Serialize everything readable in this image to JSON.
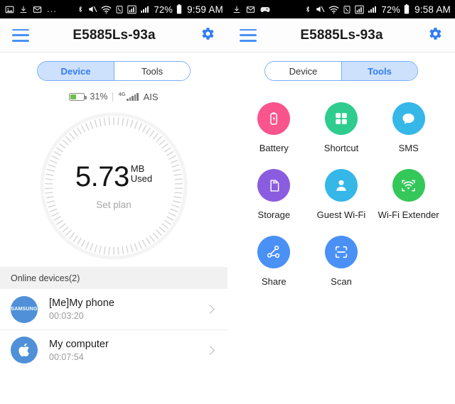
{
  "colors": {
    "accent_blue": "#4a90f5",
    "tab_active_bg": "#cde1fd",
    "tab_active_text": "#2f7cf6",
    "battery_green": "#6ec04a",
    "avatar_blue": "#4f90d8",
    "pink": "#f9548c",
    "green": "#2ecc8f",
    "sms_blue": "#35b7e8",
    "purple": "#8a5ce0",
    "cyan": "#35b7e8",
    "wifi_green": "#34c759",
    "share_blue": "#4a90f5"
  },
  "left_panel": {
    "statusbar": {
      "left_icons": [
        "image-icon",
        "download-icon",
        "mail-icon",
        "more-dots-icon"
      ],
      "right_icons": [
        "bluetooth-icon",
        "mute-icon",
        "wifi-icon",
        "call-icon",
        "signal-icon",
        "signal-2-icon"
      ],
      "battery_percent": "72%",
      "time": "9:59 AM"
    },
    "header": {
      "menu_icon": "hamburger-icon",
      "title": "E5885Ls-93a",
      "settings_icon": "gear-icon"
    },
    "tabs": [
      {
        "label": "Device",
        "active": true
      },
      {
        "label": "Tools",
        "active": false
      }
    ],
    "status_line": {
      "battery_percent": "31%",
      "network_type": "4G",
      "carrier": "AIS"
    },
    "usage": {
      "value": "5.73",
      "unit": "MB",
      "unit_sub": "Used",
      "set_plan_label": "Set plan"
    },
    "devices_section": {
      "header": "Online devices(2)",
      "items": [
        {
          "avatar": "samsung-logo-icon",
          "avatar_text": "SAMSUNG",
          "name": "[Me]My phone",
          "time": "00:03:20"
        },
        {
          "avatar": "apple-logo-icon",
          "avatar_text": "",
          "name": "My computer",
          "time": "00:07:54"
        }
      ]
    }
  },
  "right_panel": {
    "statusbar": {
      "left_icons": [
        "download-icon",
        "mail-icon",
        "game-icon"
      ],
      "right_icons": [
        "bluetooth-icon",
        "mute-icon",
        "wifi-icon",
        "call-icon",
        "signal-icon",
        "signal-2-icon"
      ],
      "battery_percent": "72%",
      "time": "9:58 AM"
    },
    "header": {
      "menu_icon": "hamburger-icon",
      "title": "E5885Ls-93a",
      "settings_icon": "gear-icon"
    },
    "tabs": [
      {
        "label": "Device",
        "active": false
      },
      {
        "label": "Tools",
        "active": true
      }
    ],
    "tools": [
      {
        "label": "Battery",
        "icon": "battery-icon",
        "color": "#f9548c"
      },
      {
        "label": "Shortcut",
        "icon": "grid-squares-icon",
        "color": "#2ecc8f"
      },
      {
        "label": "SMS",
        "icon": "speech-bubble-icon",
        "color": "#35b7e8"
      },
      {
        "label": "Storage",
        "icon": "sd-card-icon",
        "color": "#8a5ce0"
      },
      {
        "label": "Guest Wi-Fi",
        "icon": "person-icon",
        "color": "#35b7e8"
      },
      {
        "label": "Wi-Fi Extender",
        "icon": "wifi-extender-icon",
        "color": "#34c759"
      },
      {
        "label": "Share",
        "icon": "share-nodes-icon",
        "color": "#4a90f5"
      },
      {
        "label": "Scan",
        "icon": "scan-frame-icon",
        "color": "#4a90f5"
      }
    ]
  }
}
